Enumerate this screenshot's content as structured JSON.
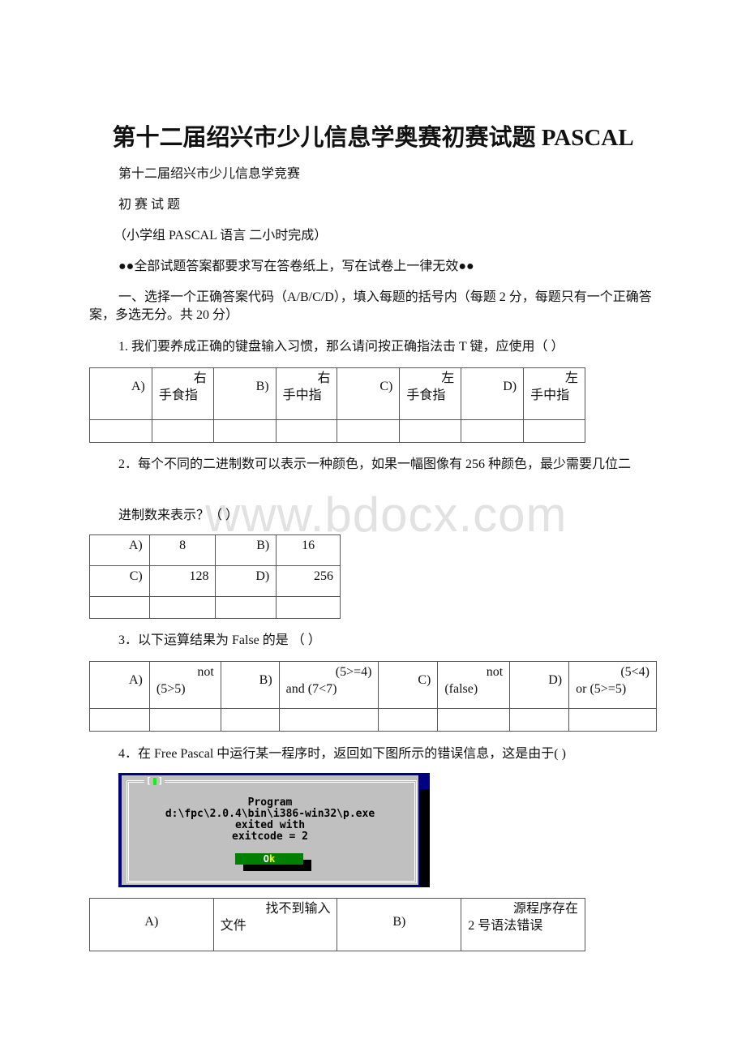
{
  "document": {
    "title": "第十二届绍兴市少儿信息学奥赛初赛试题 PASCAL",
    "subtitle": "第十二届绍兴市少儿信息学竞赛",
    "exam_name": "初 赛 试 题",
    "group_info": "（小学组 PASCAL 语言 二小时完成）",
    "notice": "●●全部试题答案都要求写在答卷纸上，写在试卷上一律无效●●",
    "section_intro": "一、选择一个正确答案代码（A/B/C/D），填入每题的括号内（每题 2 分，每题只有一个正确答案，多选无分。共 20 分）",
    "watermark": "www.bdocx.com"
  },
  "questions": [
    {
      "number": "1.",
      "text": "1. 我们要养成正确的键盘输入习惯，那么请问按正确指法击 T 键，应使用（ ）",
      "options": [
        {
          "label": "A)",
          "line1": "右",
          "line2": "手食指"
        },
        {
          "label": "B)",
          "line1": "右",
          "line2": "手中指"
        },
        {
          "label": "C)",
          "line1": "左",
          "line2": "手食指"
        },
        {
          "label": "D)",
          "line1": "左",
          "line2": "手中指"
        }
      ]
    },
    {
      "number": "2.",
      "text_line1": "2．每个不同的二进制数可以表示一种颜色，如果一幅图像有 256 种颜色，最少需要几位二",
      "text_line2": "进制数来表示？（ ）",
      "options": [
        {
          "label": "A)",
          "value": "8"
        },
        {
          "label": "B)",
          "value": "16"
        },
        {
          "label": "C)",
          "value": "128"
        },
        {
          "label": "D)",
          "value": "256"
        }
      ]
    },
    {
      "number": "3.",
      "text": "3．以下运算结果为 False 的是 （ ）",
      "options": [
        {
          "label": "A)",
          "line1": "not",
          "line2": "(5>5)"
        },
        {
          "label": "B)",
          "line1": "(5>=4)",
          "line2": "and (7<7)"
        },
        {
          "label": "C)",
          "line1": "not",
          "line2": "(false)"
        },
        {
          "label": "D)",
          "line1": "(5<4)",
          "line2": "or (5>=5)"
        }
      ]
    },
    {
      "number": "4.",
      "text": "4．在 Free Pascal 中运行某一程序时，返回如下图所示的错误信息，这是由于( )",
      "dialog": {
        "lines": [
          "Program",
          "d:\\fpc\\2.0.4\\bin\\i386-win32\\p.exe",
          "exited with",
          "exitcode = 2"
        ],
        "ok_label_first": "O",
        "ok_label_hot": "k",
        "colors": {
          "background": "#c0c0c0",
          "border": "#000080",
          "button": "#008000",
          "hotkey": "#ffff00"
        }
      },
      "options": [
        {
          "label": "A)",
          "line1": "找不到输入",
          "line2": "文件"
        },
        {
          "label": "B)",
          "line1": "源程序存在",
          "line2": "2 号语法错误"
        }
      ]
    }
  ]
}
